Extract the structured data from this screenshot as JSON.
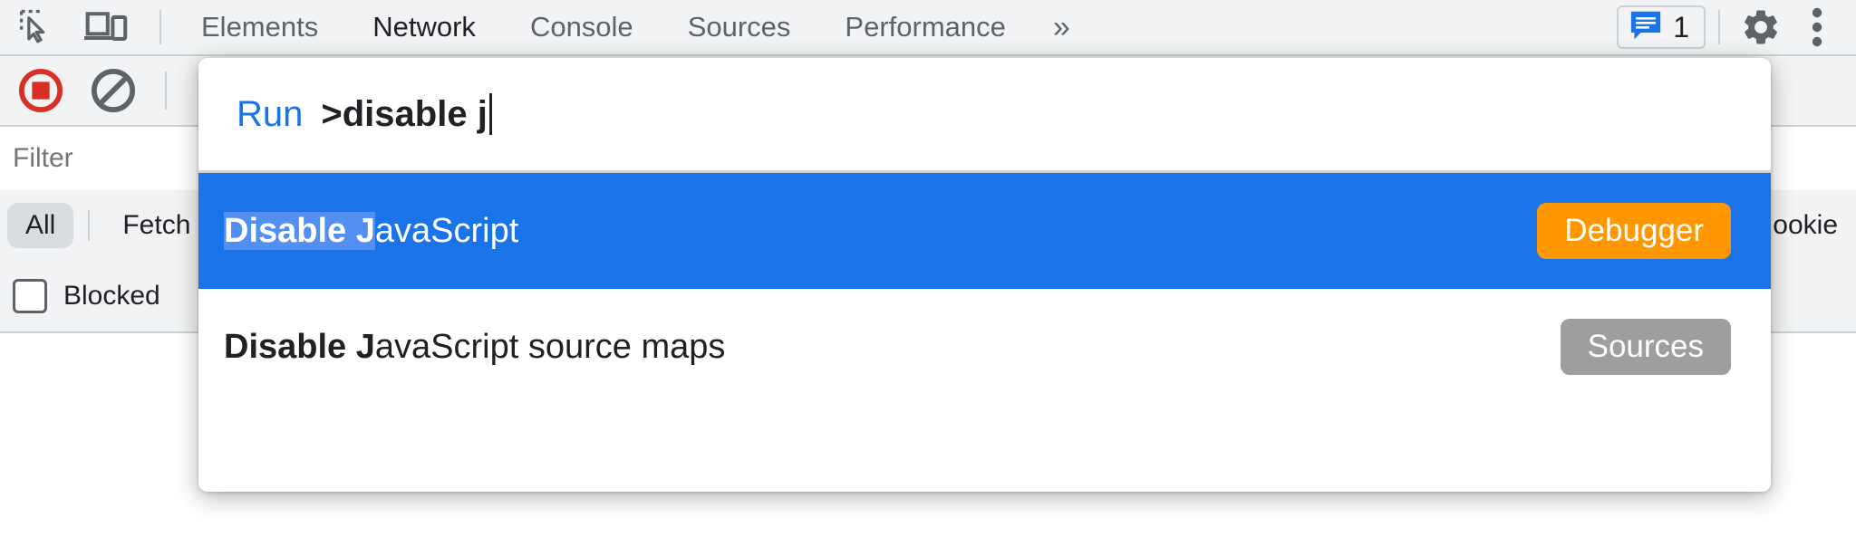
{
  "toolbar": {
    "inspect_icon": "inspect-element-icon",
    "device_icon": "device-toolbar-icon",
    "tabs": [
      {
        "label": "Elements",
        "active": false
      },
      {
        "label": "Network",
        "active": true
      },
      {
        "label": "Console",
        "active": false
      },
      {
        "label": "Sources",
        "active": false
      },
      {
        "label": "Performance",
        "active": false
      }
    ],
    "more_tabs_label": "»",
    "messages_count": "1",
    "messages_icon": "console-message-icon",
    "settings_icon": "gear-icon",
    "more_icon": "vertical-dots-icon"
  },
  "network": {
    "record_icon": "record-stop-icon",
    "clear_icon": "clear-network-icon",
    "filter_placeholder": "Filter",
    "filter_value": "",
    "types": [
      {
        "label": "All",
        "selected": true
      },
      {
        "label": "Fetch",
        "selected": false
      }
    ],
    "blocked_label": "Blocked",
    "blocked_checked": false,
    "cookies_label_partial": "ookie"
  },
  "palette": {
    "run_label": "Run",
    "query": ">disable j",
    "suggestions": [
      {
        "match": "Disable J",
        "rest": "avaScript",
        "badge": "Debugger",
        "badge_color": "#FF9800",
        "selected": true
      },
      {
        "match": "Disable J",
        "rest": "avaScript source maps",
        "badge": "Sources",
        "badge_color": "#9E9E9E",
        "selected": false
      }
    ]
  },
  "colors": {
    "accent_blue": "#1A73E8",
    "match_highlight": "#528FF0",
    "toolbar_bg": "#F1F3F4",
    "record_red": "#D93025",
    "text_primary": "#202124",
    "text_secondary": "#5F6368"
  }
}
